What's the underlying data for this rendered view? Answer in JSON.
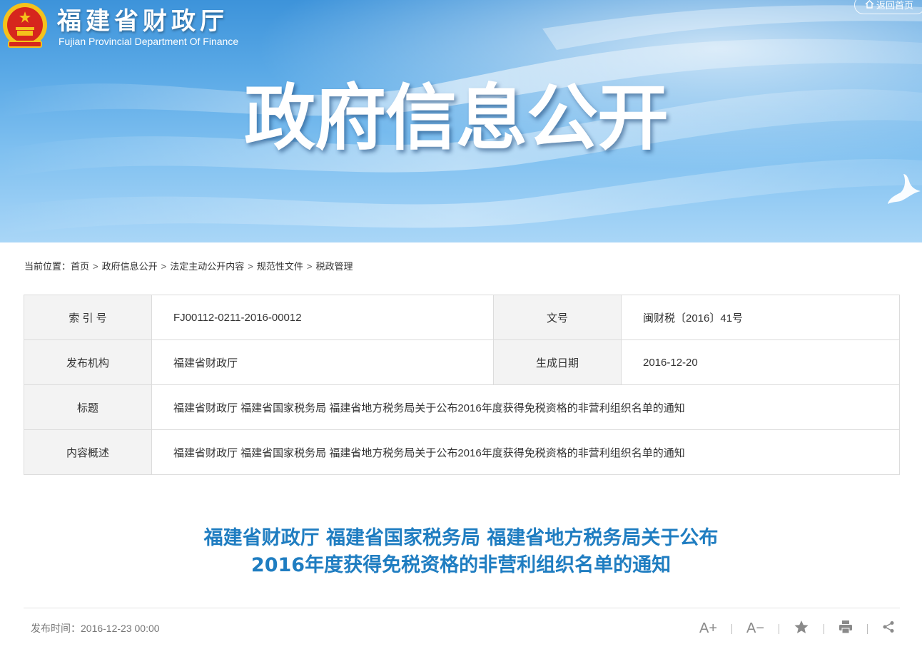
{
  "header": {
    "site_name_cn": "福建省财政厅",
    "site_name_en": "Fujian Provincial Department Of Finance",
    "home_link": "返回首页",
    "banner_title": "政府信息公开"
  },
  "breadcrumb": {
    "prefix": "当前位置：",
    "items": [
      "首页",
      "政府信息公开",
      "法定主动公开内容",
      "规范性文件",
      "税政管理"
    ],
    "separator": ">"
  },
  "meta": {
    "index_label": "索 引 号",
    "index_value": "FJ00112-0211-2016-00012",
    "docno_label": "文号",
    "docno_value": "闽财税〔2016〕41号",
    "publisher_label": "发布机构",
    "publisher_value": "福建省财政厅",
    "date_label": "生成日期",
    "date_value": "2016-12-20",
    "title_label": "标题",
    "title_value": "福建省财政厅 福建省国家税务局 福建省地方税务局关于公布2016年度获得免税资格的非营利组织名单的通知",
    "summary_label": "内容概述",
    "summary_value": "福建省财政厅 福建省国家税务局 福建省地方税务局关于公布2016年度获得免税资格的非营利组织名单的通知"
  },
  "article": {
    "title_line1": "福建省财政厅 福建省国家税务局 福建省地方税务局关于公布",
    "title_line2": "2016年度获得免税资格的非营利组织名单的通知",
    "publish_time": "发布时间：2016-12-23 00:00"
  },
  "tools": {
    "font_up": "A+",
    "font_down": "A−",
    "icons": [
      "font-increase-icon",
      "font-decrease-icon",
      "star-icon",
      "print-icon",
      "share-icon"
    ]
  },
  "colors": {
    "title_blue": "#1f7dc1",
    "banner_top": "#3d93da",
    "banner_bottom": "#a9d6f7"
  }
}
